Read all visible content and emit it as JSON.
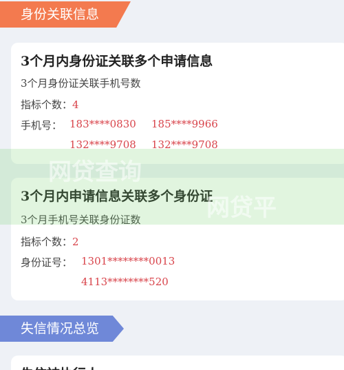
{
  "section1": {
    "title": "身份关联信息"
  },
  "card1": {
    "title": "3个月内身份证关联多个申请信息",
    "subtitle": "3个月身份证关联手机号数",
    "count_label": "指标个数：",
    "count_value": "4",
    "phone_label": "手机号：",
    "phones": [
      "183****0830",
      "185****9966",
      "132****9708",
      "132****9708"
    ]
  },
  "card2": {
    "title": "3个月内申请信息关联多个身份证",
    "subtitle": "3个月手机号关联身份证数",
    "count_label": "指标个数：",
    "count_value": "2",
    "id_label": "身份证号：",
    "ids": [
      "1301********0013",
      "4113********520"
    ]
  },
  "watermark": {
    "line1": "网贷查询",
    "line2": "网贷平"
  },
  "section2": {
    "title": "失信情况总览"
  },
  "card3": {
    "title": "失信被执行人"
  },
  "colors": {
    "accent_orange": "#f37a4f",
    "accent_blue": "#6f88d8",
    "value_red": "#d8434a"
  }
}
